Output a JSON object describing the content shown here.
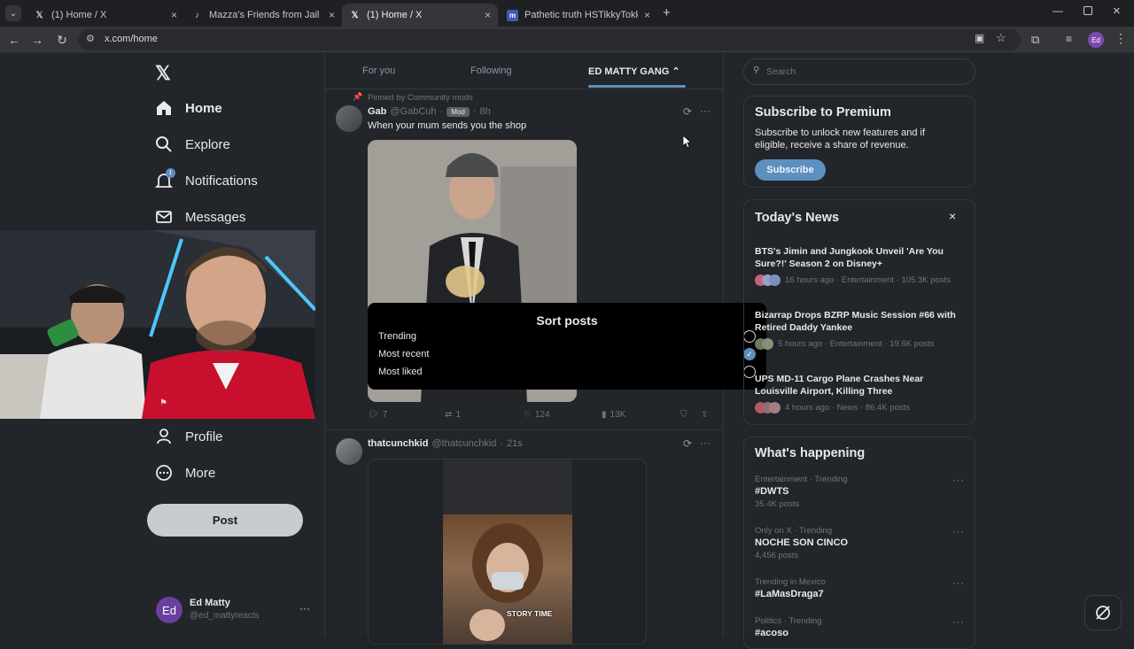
{
  "browser": {
    "tabs": [
      {
        "title": "(1) Home / X",
        "icon": "x-logo-icon"
      },
      {
        "title": "Mazza's Friends from Jail Share",
        "icon": "tiktok-icon"
      },
      {
        "title": "(1) Home / X",
        "icon": "x-logo-icon"
      },
      {
        "title": "Pathetic truth HSTikkyTokky's h",
        "icon": "site-icon"
      }
    ],
    "url": "x.com/home",
    "profile_initials": "Ed"
  },
  "sidebar": {
    "items": [
      {
        "label": "Home",
        "icon": "home-icon"
      },
      {
        "label": "Explore",
        "icon": "search-icon"
      },
      {
        "label": "Notifications",
        "icon": "bell-icon"
      },
      {
        "label": "Messages",
        "icon": "mail-icon"
      },
      {
        "label": "Profile",
        "icon": "person-icon"
      },
      {
        "label": "More",
        "icon": "more-circle-icon"
      }
    ],
    "notification_badge": "1",
    "post_label": "Post",
    "account": {
      "initials": "Ed",
      "name": "Ed Matty",
      "handle": "@ed_mattyreacts"
    }
  },
  "feed": {
    "tabs": [
      "For you",
      "Following",
      "ED MATTY GANG"
    ],
    "pinned_label": "Pinned by Community mods",
    "tweet1": {
      "name": "Gab",
      "handle": "@GabCuh",
      "badge": "Mod",
      "time": "8h",
      "text": "When your mum sends you the shop",
      "replies": "7",
      "reposts": "1",
      "likes": "124",
      "views": "13K"
    },
    "tweet2": {
      "name": "thatcunchkid",
      "handle": "@thatcunchkid",
      "time": "21s",
      "video_caption": "STORY TIME"
    }
  },
  "sort_modal": {
    "title": "Sort posts",
    "options": [
      "Trending",
      "Most recent",
      "Most liked"
    ],
    "selected": "Most recent"
  },
  "right": {
    "search_placeholder": "Search",
    "premium": {
      "title": "Subscribe to Premium",
      "text": "Subscribe to unlock new features and if eligible, receive a share of revenue.",
      "button": "Subscribe"
    },
    "news": {
      "title": "Today's News",
      "items": [
        {
          "title": "BTS's Jimin and Jungkook Unveil 'Are You Sure?!' Season 2 on Disney+",
          "meta": "16 hours ago · Entertainment · 105.3K posts"
        },
        {
          "title": "Bizarrap Drops BZRP Music Session #66 with Retired Daddy Yankee",
          "meta": "5 hours ago · Entertainment · 19.6K posts"
        },
        {
          "title": "UPS MD-11 Cargo Plane Crashes Near Louisville Airport, Killing Three",
          "meta": "4 hours ago · News · 86.4K posts"
        }
      ]
    },
    "happening": {
      "title": "What's happening",
      "trends": [
        {
          "category": "Entertainment · Trending",
          "name": "#DWTS",
          "count": "35.4K posts"
        },
        {
          "category": "Only on X · Trending",
          "name": "NOCHE SON CINCO",
          "count": "4,456 posts"
        },
        {
          "category": "Trending in Mexico",
          "name": "#LaMasDraga7",
          "count": ""
        },
        {
          "category": "Politics · Trending",
          "name": "#acoso",
          "count": ""
        }
      ]
    }
  }
}
